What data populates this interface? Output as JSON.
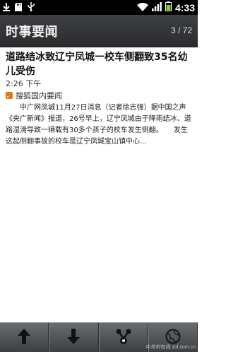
{
  "status_bar": {
    "time": "4:33",
    "icons": [
      "download-icon",
      "sd-card-icon",
      "usb-icon",
      "wifi-icon",
      "signal-icon",
      "battery-icon"
    ]
  },
  "header": {
    "title": "时事要闻",
    "counter": "3 / 72"
  },
  "article": {
    "headline": "道路结冰致辽宁凤城一校车侧翻致35名幼儿受伤",
    "time": "2:26 下午",
    "source": "搜狐国内要闻",
    "body": "中广网凤城11月27日消息（记者徐志强）据中国之声《央广新闻》报道，26号早上，辽宁凤城由于降雨结冰、道路湿滑导致一辆载有30多个孩子的校车发生侧翻。　　发生这起侧翻事故的校车是辽宁凤城宝山镇中心..."
  },
  "toolbar": {
    "buttons": [
      "previous-article",
      "next-article",
      "share",
      "browser"
    ]
  },
  "watermark": "中关村在线 zol.com.cn",
  "colors": {
    "accent_orange": "#e07b12",
    "title_bar": "#2f3133",
    "status_bar": "#000000"
  }
}
